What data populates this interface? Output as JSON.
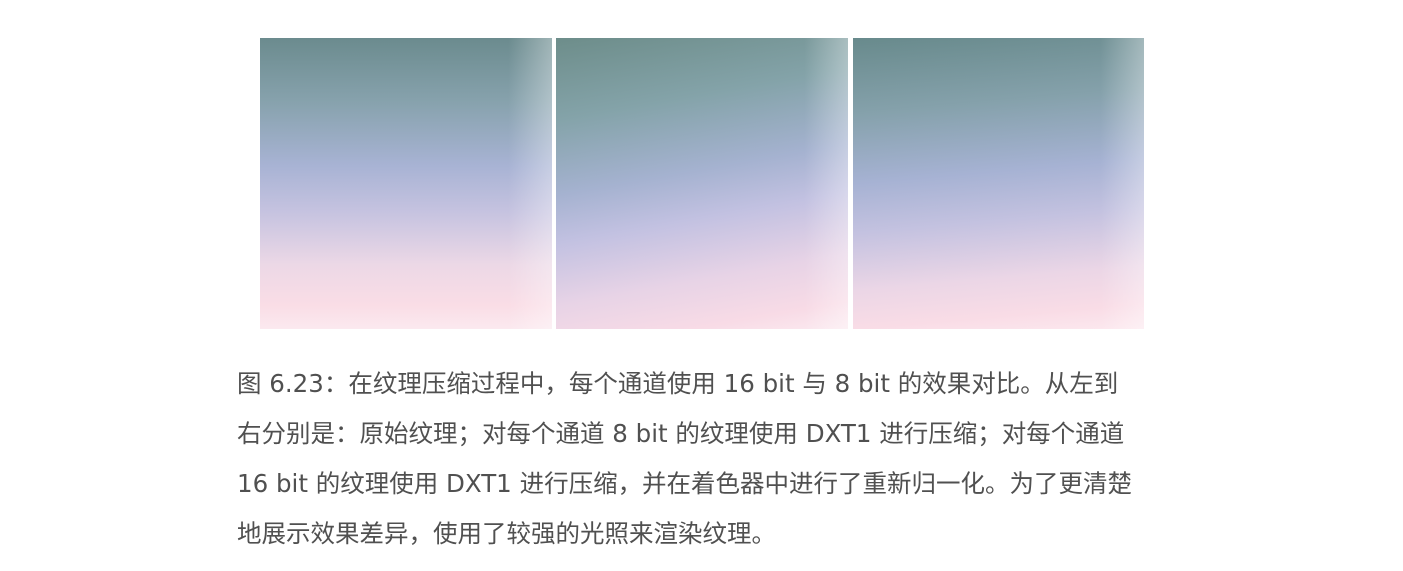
{
  "figure": {
    "panels": [
      {
        "name": "original-texture"
      },
      {
        "name": "dxt1-8bit-texture"
      },
      {
        "name": "dxt1-16bit-renormalized-texture"
      }
    ],
    "colors": {
      "top": "#6b8b8e",
      "middle": "#a8b3d4",
      "bottom": "#fadde6"
    }
  },
  "caption": {
    "lines": [
      "图 6.23：在纹理压缩过程中，每个通道使用 16 bit 与 8 bit 的效果对比。从左到",
      "右分别是：原始纹理；对每个通道 8 bit 的纹理使用 DXT1 进行压缩；对每个通道",
      "16 bit 的纹理使用 DXT1 进行压缩，并在着色器中进行了重新归一化。为了更清楚",
      "地展示效果差异，使用了较强的光照来渲染纹理。"
    ]
  }
}
